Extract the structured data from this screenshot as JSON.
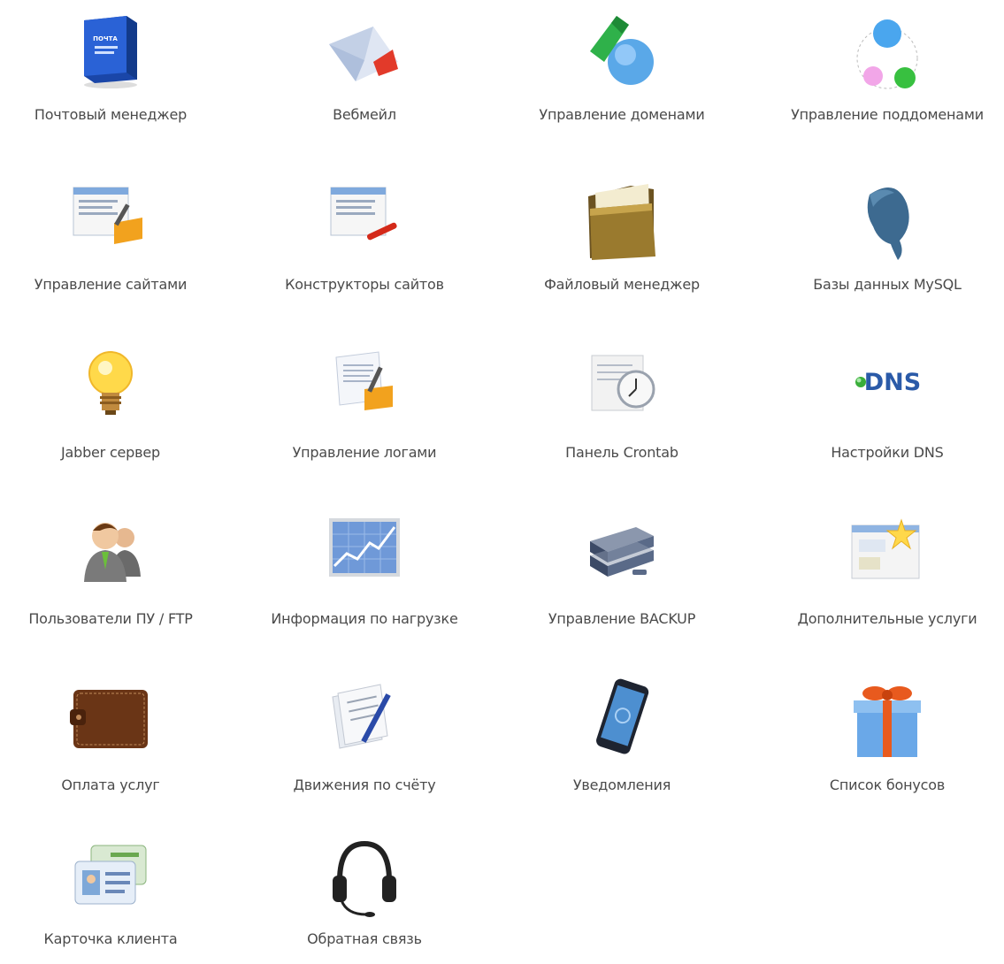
{
  "tiles": [
    {
      "label": "Почтовый менеджер",
      "icon": "mail-box-icon"
    },
    {
      "label": "Вебмейл",
      "icon": "envelope-icon"
    },
    {
      "label": "Управление доменами",
      "icon": "domains-icon"
    },
    {
      "label": "Управление поддоменами",
      "icon": "subdomains-icon"
    },
    {
      "label": "Управление сайтами",
      "icon": "site-manager-icon"
    },
    {
      "label": "Конструкторы сайтов",
      "icon": "site-builder-icon"
    },
    {
      "label": "Файловый менеджер",
      "icon": "folder-icon"
    },
    {
      "label": "Базы данных MySQL",
      "icon": "dolphin-icon"
    },
    {
      "label": "Jabber сервер",
      "icon": "lightbulb-icon"
    },
    {
      "label": "Управление логами",
      "icon": "logs-icon"
    },
    {
      "label": "Панель Crontab",
      "icon": "clock-icon"
    },
    {
      "label": "Настройки DNS",
      "icon": "dns-icon"
    },
    {
      "label": "Пользователи ПУ / FTP",
      "icon": "users-icon"
    },
    {
      "label": "Информация по нагрузке",
      "icon": "load-chart-icon"
    },
    {
      "label": "Управление BACKUP",
      "icon": "server-icon"
    },
    {
      "label": "Дополнительные услуги",
      "icon": "extra-services-icon"
    },
    {
      "label": "Оплата услуг",
      "icon": "wallet-icon"
    },
    {
      "label": "Движения по счёту",
      "icon": "document-pen-icon"
    },
    {
      "label": "Уведомления",
      "icon": "smartphone-icon"
    },
    {
      "label": "Список бонусов",
      "icon": "gift-icon"
    },
    {
      "label": "Карточка клиента",
      "icon": "client-card-icon"
    },
    {
      "label": "Обратная связь",
      "icon": "headset-icon"
    }
  ],
  "mail_icon_text": "ПОЧТА",
  "dns_icon_text": "DNS",
  "colors": {
    "label": "#4a4a4a",
    "mail_blue": "#1e4fb8",
    "dns_blue": "#2a5aa8",
    "green": "#35b535",
    "gift_red": "#e85a1e"
  }
}
